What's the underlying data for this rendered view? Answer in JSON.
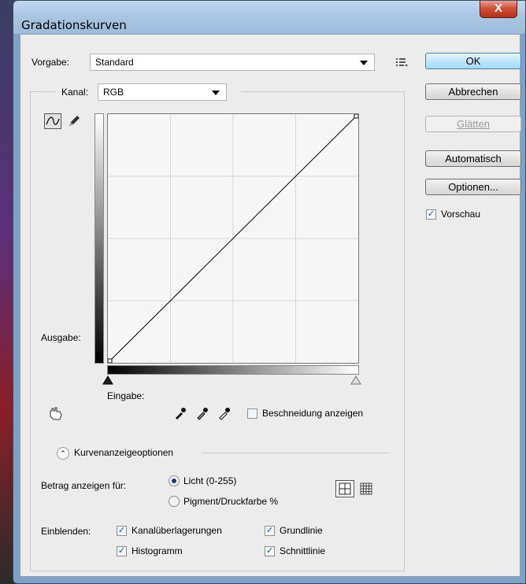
{
  "window": {
    "title": "Gradationskurven",
    "close_label": "X"
  },
  "preset": {
    "label": "Vorgabe:",
    "value": "Standard"
  },
  "channel": {
    "label": "Kanal:",
    "value": "RGB"
  },
  "buttons": {
    "ok": "OK",
    "cancel": "Abbrechen",
    "smooth": "Glätten",
    "auto": "Automatisch",
    "options": "Optionen..."
  },
  "preview": {
    "label": "Vorschau",
    "checked": true
  },
  "graph": {
    "output_label": "Ausgabe:",
    "input_label": "Eingabe:"
  },
  "clipping": {
    "label": "Beschneidung anzeigen",
    "checked": false
  },
  "curve_options": {
    "label": "Kurvenanzeigeoptionen"
  },
  "amount": {
    "label": "Betrag anzeigen für:",
    "option_light": "Licht (0-255)",
    "option_pigment": "Pigment/Druckfarbe %",
    "selected": "light"
  },
  "show": {
    "label": "Einblenden:",
    "channel_overlays": "Kanalüberlagerungen",
    "baseline": "Grundlinie",
    "histogram": "Histogramm",
    "intersection": "Schnittlinie"
  }
}
